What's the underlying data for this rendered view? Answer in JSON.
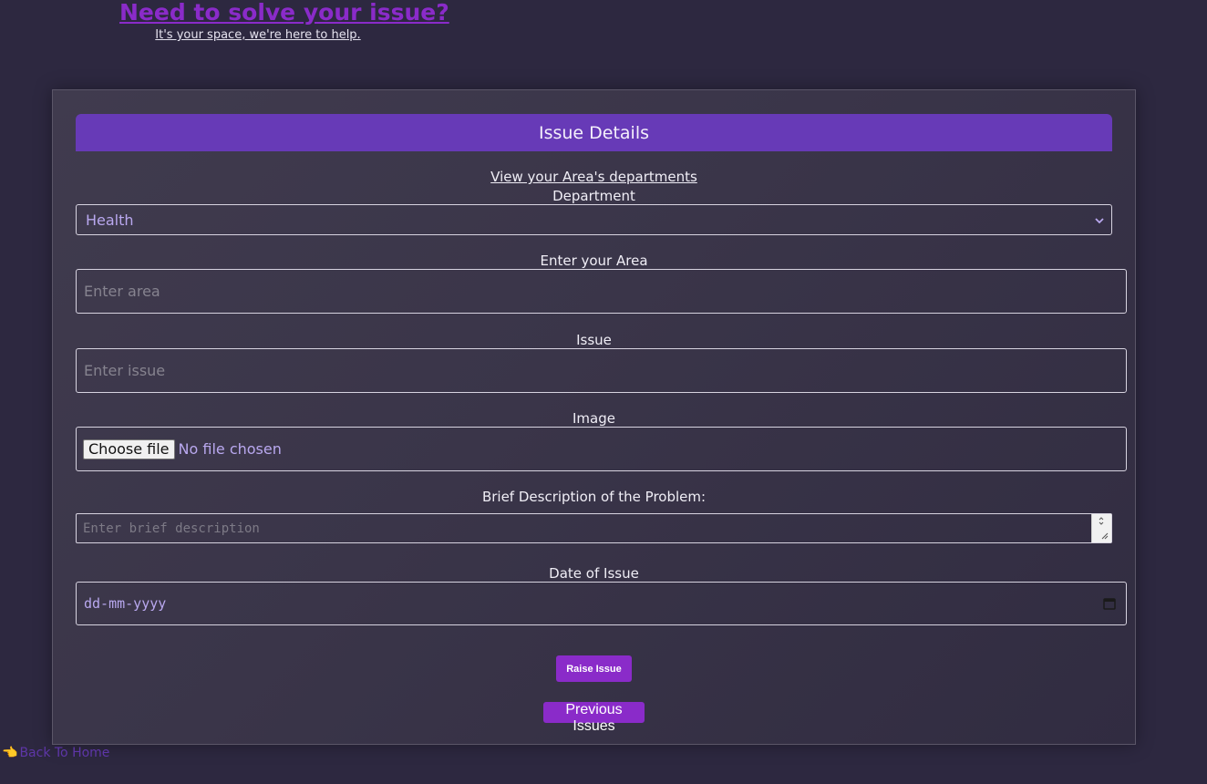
{
  "header": {
    "title": "Need to solve your issue?",
    "subtitle": "It's your space, we're here to help."
  },
  "form": {
    "header_title": "Issue Details",
    "departments_link": "View your Area's departments",
    "department_label": "Department",
    "department_value": "Health",
    "area_label": "Enter your Area",
    "area_placeholder": "Enter area",
    "issue_label": "Issue",
    "issue_placeholder": "Enter issue",
    "image_label": "Image",
    "file_button_label": "Choose file",
    "file_status": "No file chosen",
    "description_label": "Brief Description of the Problem:",
    "description_placeholder": "Enter brief description",
    "date_label": "Date of Issue",
    "date_placeholder": "dd-mm-yyyy",
    "raise_button_label": "Raise Issue",
    "previous_button_label": "Previous Issues"
  },
  "footer": {
    "back_home_label": "Back To Home",
    "back_icon": "👈"
  },
  "colors": {
    "background": "#2d2840",
    "accent": "#8a2bc9",
    "card_header": "#673ab7",
    "input_text": "#b9a8ef"
  },
  "icons": {
    "select": "chevron-down-icon",
    "date": "calendar-icon",
    "back": "pointing-hand-icon"
  }
}
